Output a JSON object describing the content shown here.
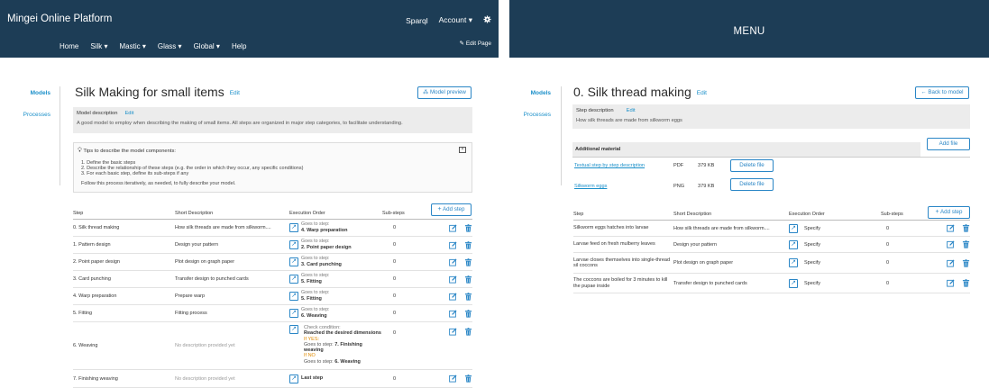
{
  "left_header": {
    "brand": "Mingei Online Platform",
    "sparql": "Sparql",
    "account": "Account",
    "gear_icon": "gear-icon",
    "nav": [
      "Home",
      "Silk",
      "Mastic",
      "Glass",
      "Global",
      "Help"
    ],
    "edit_page": "Edit Page"
  },
  "right_header": {
    "menu": "MENU"
  },
  "left_page": {
    "sidenav": [
      "Models",
      "Processes"
    ],
    "title": "Silk Making for small items",
    "title_edit": "Edit",
    "model_preview": "Model preview",
    "model_description_label": "Model description",
    "model_description_edit": "Edit",
    "model_description_text": "A good model to employ when describing the making of small items. All steps are organized in major step categories, to facilitate understanding.",
    "tips_title": "Tips to describe the model components:",
    "tips": [
      "1. Define the basic steps",
      "2. Describe the relationship of these steps (e.g. the order in which they occur, any specific conditions)",
      "3. For each basic step, define its sub-steps if any"
    ],
    "tips_footer": "Follow this process iteratively, as needed, to fully describe your model.",
    "add_step": "Add step",
    "columns": [
      "Step",
      "Short Description",
      "Execution Order",
      "Sub-steps"
    ],
    "rows": [
      {
        "step": "0. Silk thread making",
        "desc": "How silk threads are made from silkworm....",
        "g1": "Goes to step:",
        "g2": "4. Warp preparation",
        "sub": "0"
      },
      {
        "step": "1. Pattern design",
        "desc": "Design your pattern",
        "g1": "Goes to step:",
        "g2": "2. Point paper design",
        "sub": "0"
      },
      {
        "step": "2. Point paper design",
        "desc": "Plot design on graph paper",
        "g1": "Goes to step:",
        "g2": "3. Card punching",
        "sub": "0"
      },
      {
        "step": "3. Card punching",
        "desc": "Transfer design to punched cards",
        "g1": "Goes to step:",
        "g2": "5. Fitting",
        "sub": "0"
      },
      {
        "step": "4. Warp preparation",
        "desc": "Prepare warp",
        "g1": "Goes to step:",
        "g2": "5. Fitting",
        "sub": "0"
      },
      {
        "step": "5. Fitting",
        "desc": "Fitting process",
        "g1": "Goes to step:",
        "g2": "6. Weaving",
        "sub": "0"
      }
    ],
    "weaving_row": {
      "step": "6. Weaving",
      "desc": "No description provided yet",
      "check": "Check condition:",
      "condition": "Reached the desired dimensions",
      "if_yes": "If YES:",
      "yes_goes": "Goes to step:",
      "yes_target": "7. Finishing weaving",
      "if_no": "If NO",
      "no_goes": "Goes to step:",
      "no_target": "6. Weaving",
      "sub": "0"
    },
    "finishing_row": {
      "step": "7. Finishing weaving",
      "desc": "No description provided yet",
      "order": "Last step",
      "sub": "0"
    }
  },
  "right_page": {
    "sidenav": [
      "Models",
      "Processes"
    ],
    "title": "0. Silk thread making",
    "title_edit": "Edit",
    "back_button": "Back to model",
    "step_description_label": "Step description",
    "step_description_edit": "Edit",
    "step_description_text": "How silk threads are made from silkworm eggs",
    "additional_material": "Additional material",
    "add_file": "Add file",
    "files": [
      {
        "name": "Textual step by step description",
        "type": "PDF",
        "size": "379 KB",
        "action": "Delete file"
      },
      {
        "name": "Silkworm eggs",
        "type": "PNG",
        "size": "379 KB",
        "action": "Delete file"
      }
    ],
    "add_step": "Add step",
    "columns": [
      "Step",
      "Short Description",
      "Execution Order",
      "Sub-steps"
    ],
    "rows": [
      {
        "step": "Silkworm eggs hatches into larvae",
        "desc": "How silk threads are made from silkworm....",
        "order": "Specify",
        "sub": "0"
      },
      {
        "step": "Larvae feed on fresh mulberry leaves",
        "desc": "Design your pattern",
        "order": "Specify",
        "sub": "0"
      },
      {
        "step": "Larvae closes themselves into single-thread sil coccons",
        "desc": "Plot design on graph paper",
        "order": "Specify",
        "sub": "0"
      },
      {
        "step": "The coccons are boiled for 3 minutes to kill the pupae inside",
        "desc": "Transfer design to punched cards",
        "order": "Specify",
        "sub": "0"
      }
    ]
  },
  "colors": {
    "header_bg": "#1d3d56",
    "accent": "#1a8fc9",
    "condition_yes": "#e08a00"
  },
  "icons": {
    "execution": "wrench-icon",
    "edit": "edit-icon",
    "delete": "trash-icon",
    "tips": "lightbulb-icon",
    "collapse": "collapse-icon",
    "model_preview": "model-icon",
    "back": "arrow-left-icon",
    "add": "plus-icon"
  }
}
